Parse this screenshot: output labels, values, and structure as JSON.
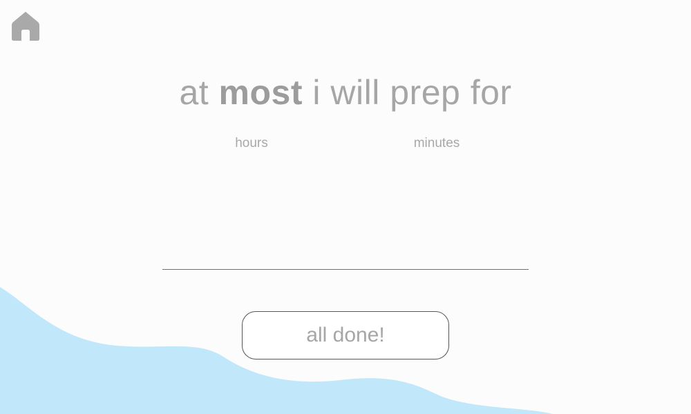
{
  "header": {
    "home_icon": "home-icon"
  },
  "headline": {
    "prefix": "at ",
    "emphasis": "most",
    "suffix": " i will prep for"
  },
  "time_picker": {
    "hours_label": "hours",
    "minutes_label": "minutes"
  },
  "actions": {
    "done_label": "all done!"
  },
  "colors": {
    "background": "#fcfcfc",
    "wave": "#c1e7fa",
    "text": "#a6a6a6",
    "icon": "#a9a9a9"
  }
}
